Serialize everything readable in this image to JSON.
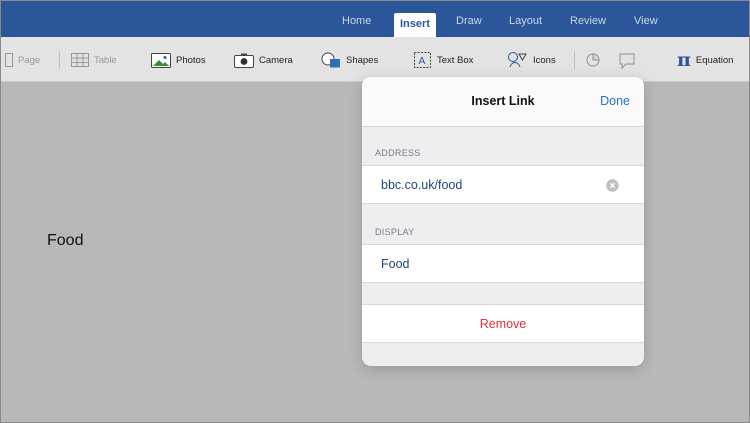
{
  "ribbon": {
    "tabs": [
      {
        "label": "Home"
      },
      {
        "label": "Insert",
        "active": true
      },
      {
        "label": "Draw"
      },
      {
        "label": "Layout"
      },
      {
        "label": "Review"
      },
      {
        "label": "View"
      }
    ]
  },
  "toolbar": {
    "page": "Page",
    "table": "Table",
    "photos": "Photos",
    "camera": "Camera",
    "shapes": "Shapes",
    "text_box": "Text Box",
    "icons": "Icons",
    "equation": "Equation"
  },
  "document": {
    "text": "Food"
  },
  "dialog": {
    "title": "Insert Link",
    "done": "Done",
    "address_label": "ADDRESS",
    "address_value": "bbc.co.uk/food",
    "display_label": "DISPLAY",
    "display_value": "Food",
    "remove": "Remove"
  },
  "colors": {
    "ribbon": "#2b579a",
    "link_blue": "#2a6fcf",
    "destructive_red": "#e0303a"
  }
}
